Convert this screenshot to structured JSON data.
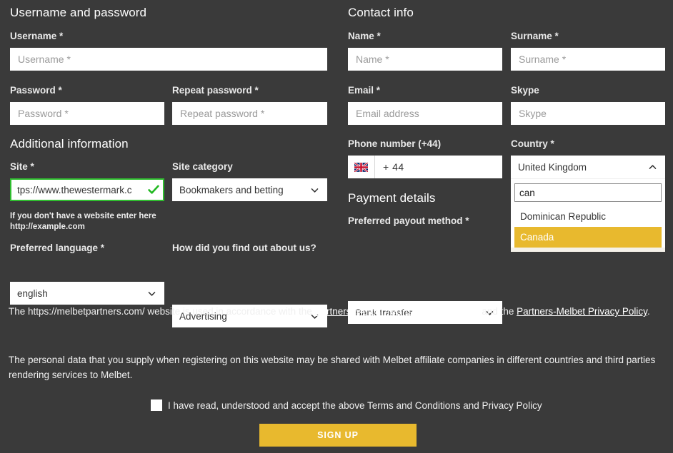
{
  "theme": {
    "background": "#3a3a3a",
    "accent_gold": "#e8b92e",
    "valid_green": "#2fbd2f",
    "input_background": "#ffffff",
    "text": "#ffffff"
  },
  "sections": {
    "username_password": {
      "title": "Username and password"
    },
    "additional_information": {
      "title": "Additional information"
    },
    "contact_info": {
      "title": "Contact info"
    },
    "payment_details": {
      "title": "Payment details"
    }
  },
  "fields": {
    "username": {
      "label": "Username *",
      "placeholder": "Username *",
      "value": ""
    },
    "password": {
      "label": "Password *",
      "placeholder": "Password *",
      "value": ""
    },
    "repeat_password": {
      "label": "Repeat password *",
      "placeholder": "Repeat password *",
      "value": ""
    },
    "site": {
      "label": "Site *",
      "value": "tps://www.thewestermark.c",
      "valid": true,
      "hint_line1": "If you don't have a website enter here",
      "hint_line2": "http://example.com"
    },
    "site_category": {
      "label": "Site category",
      "selected": "Bookmakers and betting"
    },
    "preferred_language": {
      "label": "Preferred language *",
      "selected": "english"
    },
    "how_found": {
      "label": "How did you find out about us?",
      "selected": "Advertising"
    },
    "name": {
      "label": "Name *",
      "placeholder": "Name *",
      "value": ""
    },
    "surname": {
      "label": "Surname *",
      "placeholder": "Surname *",
      "value": ""
    },
    "email": {
      "label": "Email *",
      "placeholder": "Email address",
      "value": ""
    },
    "skype": {
      "label": "Skype",
      "placeholder": "Skype",
      "value": ""
    },
    "phone": {
      "label": "Phone number (+44)",
      "flag": "united-kingdom-flag",
      "value": "+ 44"
    },
    "country": {
      "label": "Country *",
      "selected": "United Kingdom",
      "open": true,
      "search_value": "can",
      "search_placeholder": "",
      "options": [
        "Dominican Republic",
        "Canada"
      ],
      "highlighted_option": "Canada"
    },
    "payout_method": {
      "label": "Preferred payout method *",
      "selected": "Bank transfer"
    }
  },
  "legal": {
    "paragraph1_part1": "The https://melbetpartners.com/ website is used in accordance with the ",
    "link_terms": "Partners-Melbet Terms and Conditions",
    "paragraph1_part2": " and the ",
    "link_privacy": "Partners-Melbet Privacy Policy",
    "paragraph1_part3": ".",
    "paragraph2": "The personal data that you supply when registering on this website may be shared with Melbet affiliate companies in different countries and third parties rendering services to Melbet."
  },
  "consent": {
    "checked": false,
    "label": "I have read, understood and accept the above Terms and Conditions and Privacy Policy"
  },
  "submit": {
    "label": "SIGN UP"
  }
}
